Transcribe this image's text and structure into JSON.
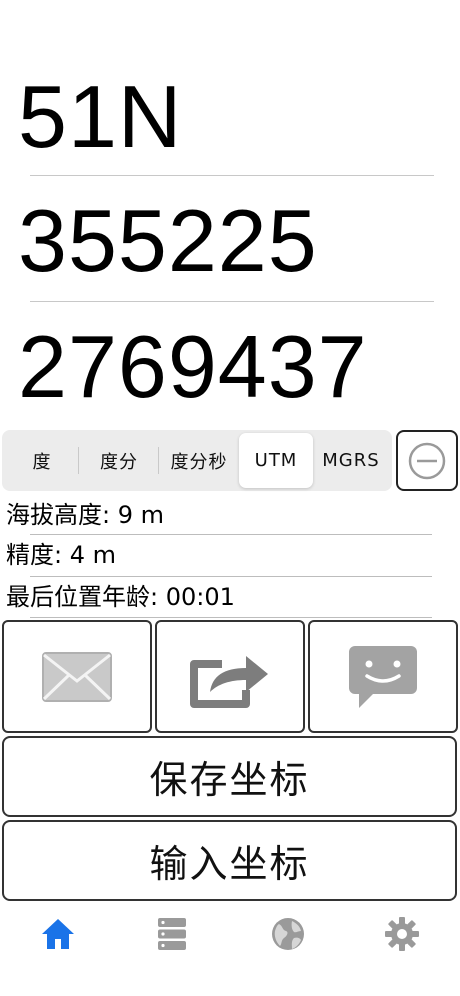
{
  "coordinates": {
    "zone": "51N",
    "easting": "355225",
    "northing": "2769437"
  },
  "format_selector": {
    "options": [
      "度",
      "度分",
      "度分秒",
      "UTM",
      "MGRS"
    ],
    "selected": "UTM"
  },
  "collapse_button": {
    "icon": "minus-circle-icon"
  },
  "info": {
    "altitude": "海拔高度: 9 m",
    "accuracy": "精度: 4 m",
    "last_fix_age": "最后位置年龄: 00:01"
  },
  "share_actions": [
    {
      "icon": "envelope-icon"
    },
    {
      "icon": "share-icon"
    },
    {
      "icon": "message-bubble-icon"
    }
  ],
  "buttons": {
    "save": "保存坐标",
    "input": "输入坐标"
  },
  "tabbar": {
    "tabs": [
      {
        "icon": "home-icon",
        "active": true
      },
      {
        "icon": "list-stack-icon",
        "active": false
      },
      {
        "icon": "globe-icon",
        "active": false
      },
      {
        "icon": "gear-icon",
        "active": false
      }
    ],
    "active_color": "#1a73e8",
    "inactive_color": "#9a9a9a"
  }
}
